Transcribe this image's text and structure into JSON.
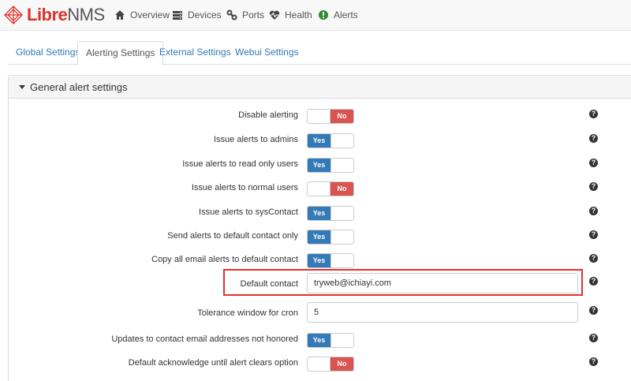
{
  "brand": {
    "libre": "Libre",
    "nms": "NMS"
  },
  "nav": {
    "overview": "Overview",
    "devices": "Devices",
    "ports": "Ports",
    "health": "Health",
    "alerts": "Alerts"
  },
  "tabs": {
    "global": "Global Settings",
    "alerting": "Alerting Settings",
    "external": "External Settings",
    "webui": "Webui Settings"
  },
  "panel": {
    "title": "General alert settings"
  },
  "toggle_labels": {
    "yes": "Yes",
    "no": "No"
  },
  "settings": [
    {
      "label": "Disable alerting",
      "type": "toggle",
      "value": "No"
    },
    {
      "label": "Issue alerts to admins",
      "type": "toggle",
      "value": "Yes"
    },
    {
      "label": "Issue alerts to read only users",
      "type": "toggle",
      "value": "Yes"
    },
    {
      "label": "Issue alerts to normal users",
      "type": "toggle",
      "value": "No"
    },
    {
      "label": "Issue alerts to sysContact",
      "type": "toggle",
      "value": "Yes"
    },
    {
      "label": "Send alerts to default contact only",
      "type": "toggle",
      "value": "Yes"
    },
    {
      "label": "Copy all email alerts to default contact",
      "type": "toggle",
      "value": "Yes"
    },
    {
      "label": "Default contact",
      "type": "text",
      "value": "tryweb@ichiayi.com"
    },
    {
      "label": "Tolerance window for cron",
      "type": "text",
      "value": "5"
    },
    {
      "label": "Updates to contact email addresses not honored",
      "type": "toggle",
      "value": "Yes"
    },
    {
      "label": "Default acknowledge until alert clears option",
      "type": "toggle",
      "value": "No"
    }
  ],
  "colors": {
    "yes": "#337ab7",
    "no": "#d9534f",
    "highlight": "#e0322f",
    "brand": "#d9332b"
  }
}
